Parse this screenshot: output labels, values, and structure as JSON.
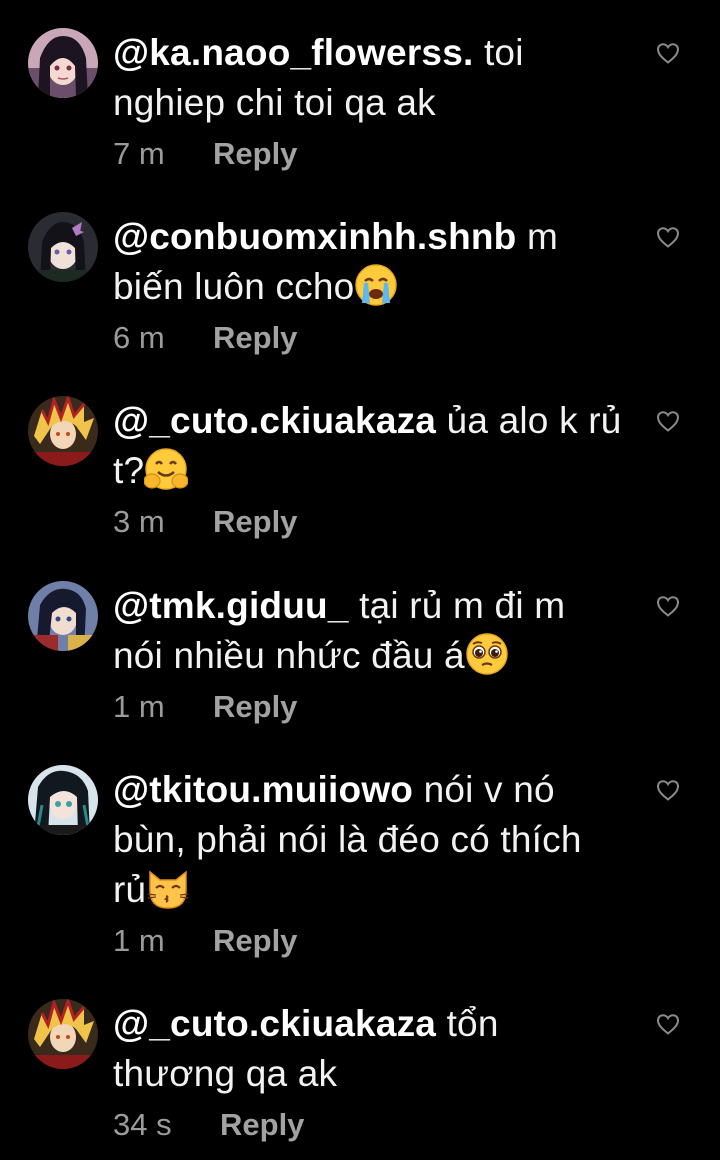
{
  "colors": {
    "background": "#000000",
    "text": "#f2f2f2",
    "meta": "#9b9b9b",
    "heart_outline": "#8a8a8a"
  },
  "comments": [
    {
      "username": "@ka.naoo_flowerss.",
      "text": "toi nghiep chi toi qa ak",
      "time": "7 m",
      "reply_label": "Reply",
      "like_icon": "heart-outline-icon",
      "avatar": "anime-girl-dark-hair-avatar"
    },
    {
      "username": "@conbuomxinhh.shnb",
      "text": "m biến luôn ccho",
      "emoji": "loudly-crying-face",
      "time": "6 m",
      "reply_label": "Reply",
      "like_icon": "heart-outline-icon",
      "avatar": "anime-girl-butterfly-avatar"
    },
    {
      "username": "@_cuto.ckiuakaza",
      "text": "ủa alo k rủ t?",
      "emoji": "hugging-face",
      "time": "3 m",
      "reply_label": "Reply",
      "like_icon": "heart-outline-icon",
      "avatar": "anime-flame-hair-avatar"
    },
    {
      "username": "@tmk.giduu_",
      "text": "tại rủ m đi m nói nhiều nhức đầu á",
      "emoji": "pleading-face",
      "time": "1 m",
      "reply_label": "Reply",
      "like_icon": "heart-outline-icon",
      "avatar": "anime-boy-dark-hair-avatar"
    },
    {
      "username": "@tkitou.muiiowo",
      "text": "nói v nó bùn, phải nói là đéo có thích rủ",
      "emoji": "kissing-cat",
      "time": "1 m",
      "reply_label": "Reply",
      "like_icon": "heart-outline-icon",
      "avatar": "anime-boy-teal-eyes-avatar"
    },
    {
      "username": "@_cuto.ckiuakaza",
      "text": "tổn thương qa ak",
      "time": "34 s",
      "reply_label": "Reply",
      "like_icon": "heart-outline-icon",
      "avatar": "anime-flame-hair-avatar"
    }
  ]
}
